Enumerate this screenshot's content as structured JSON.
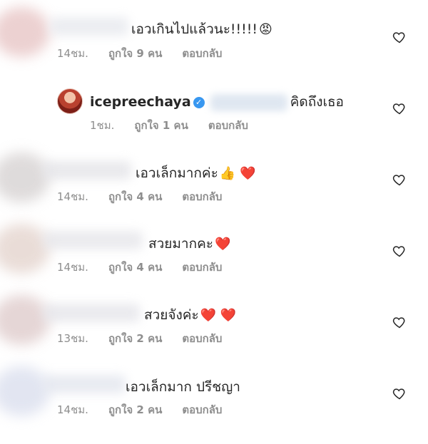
{
  "comments": [
    {
      "text": "เอวเกินไปแล้วนะ!!!!!",
      "emoji": "😡",
      "time": "14ชม.",
      "likes": "ถูกใจ 9 คน",
      "reply": "ตอบกลับ"
    },
    {
      "username": "icepreechaya",
      "text": "คิดถึงเธอ",
      "time": "1ชม.",
      "likes": "ถูกใจ 1 คน",
      "reply": "ตอบกลับ"
    },
    {
      "text": "เอวเล็กมากค่ะ",
      "emoji": "👍 ❤️",
      "time": "14ชม.",
      "likes": "ถูกใจ 4 คน",
      "reply": "ตอบกลับ"
    },
    {
      "text": "สวยมากคะ",
      "emoji": "❤️",
      "time": "14ชม.",
      "likes": "ถูกใจ 4 คน",
      "reply": "ตอบกลับ"
    },
    {
      "text": "สวยจังค่ะ",
      "emoji": "❤️ ❤️",
      "time": "13ชม.",
      "likes": "ถูกใจ 2 คน",
      "reply": "ตอบกลับ"
    },
    {
      "text": "เอวเล็กมาก ปรีชญา",
      "time": "14ชม.",
      "likes": "ถูกใจ 2 คน",
      "reply": "ตอบกลับ"
    }
  ],
  "icons": {
    "heart": "heart-outline-icon",
    "verified": "verified-badge-icon"
  },
  "colors": {
    "meta": "#8e8e8e",
    "text": "#262626",
    "verified": "#3897f0"
  }
}
